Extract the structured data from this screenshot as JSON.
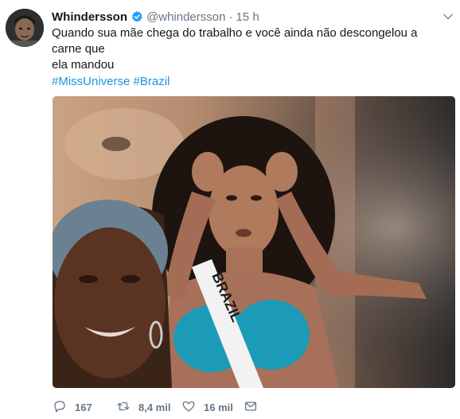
{
  "tweet": {
    "author_name": "Whindersson",
    "handle": "@whindersson",
    "separator": "·",
    "time": "15 h",
    "text_line1": "Quando sua mãe chega do trabalho e você ainda não descongelou a carne que",
    "text_line2": "ela mandou",
    "hashtags": [
      "#MissUniverse",
      "#Brazil"
    ],
    "media_sash_text": "BRAZIL"
  },
  "actions": {
    "replies": "167",
    "retweets": "8,4 mil",
    "likes": "16 mil"
  },
  "colors": {
    "link": "#1b95e0",
    "muted": "#657786",
    "text": "#14171a",
    "verified": "#1da1f2"
  },
  "icons": [
    "verified-badge-icon",
    "caret-down-icon",
    "reply-icon",
    "retweet-icon",
    "like-icon",
    "message-icon"
  ]
}
